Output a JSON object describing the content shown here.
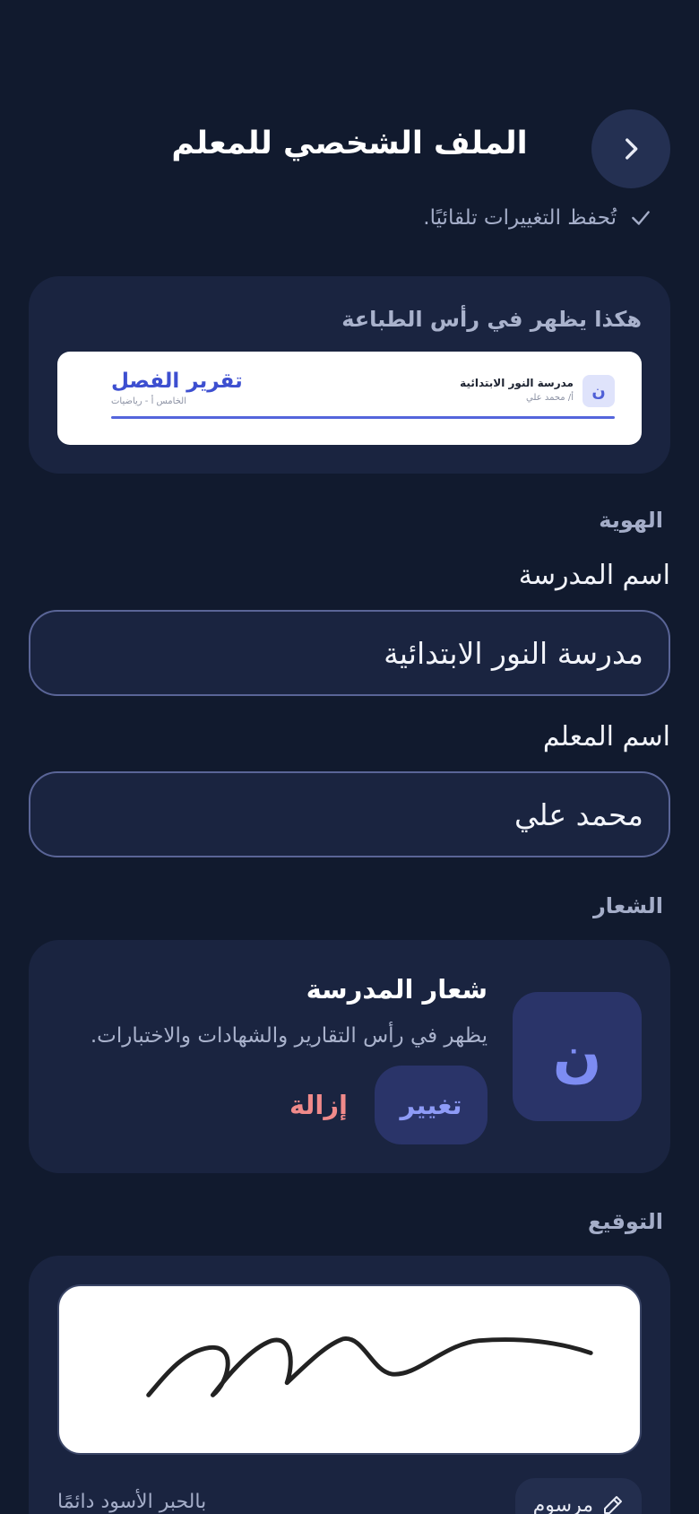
{
  "header": {
    "title": "الملف الشخصي للمعلم",
    "autosave_text": "تُحفظ التغييرات تلقائيًا."
  },
  "preview": {
    "caption": "هكذا يظهر في رأس الطباعة",
    "logo_letter": "ن",
    "school_name": "مدرسة النور الابتدائية",
    "teacher_line": "أ/ محمد علي",
    "report_title": "تقرير الفصل",
    "report_subtitle": "الخامس أ - رياضيات"
  },
  "identity": {
    "section_label": "الهوية",
    "school_label": "اسم المدرسة",
    "school_value": "مدرسة النور الابتدائية",
    "teacher_label": "اسم المعلم",
    "teacher_value": "محمد علي"
  },
  "logo": {
    "section_label": "الشعار",
    "letter": "ن",
    "title": "شعار المدرسة",
    "description": "يظهر في رأس التقارير والشهادات والاختبارات.",
    "change_label": "تغيير",
    "remove_label": "إزالة"
  },
  "signature": {
    "section_label": "التوقيع",
    "mode_label": "مرسوم",
    "hint": "بالحبر الأسود دائمًا"
  },
  "colors": {
    "background": "#111a2e",
    "card": "#1a2440",
    "accent": "#7d8cf3",
    "danger": "#f08a8a"
  }
}
